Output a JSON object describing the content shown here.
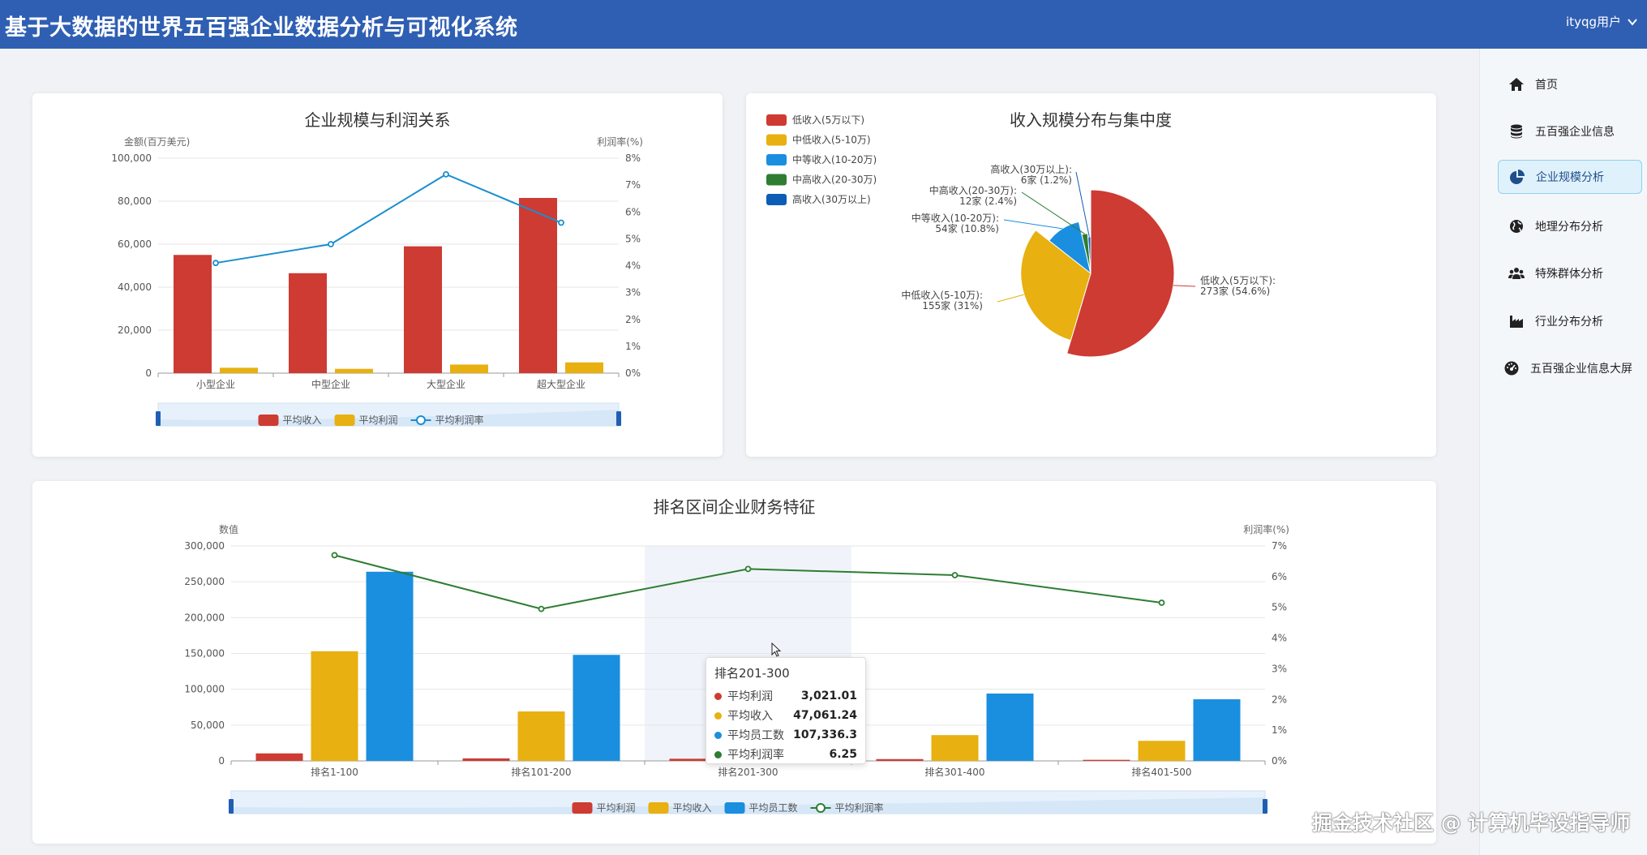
{
  "header": {
    "title": "基于大数据的世界五百强企业数据分析与可视化系统",
    "user": "ityqg用户"
  },
  "sidebar": {
    "items": [
      {
        "label": "首页",
        "icon": "home-icon",
        "active": false
      },
      {
        "label": "五百强企业信息",
        "icon": "database-icon",
        "active": false
      },
      {
        "label": "企业规模分析",
        "icon": "pie-chart-icon",
        "active": true
      },
      {
        "label": "地理分布分析",
        "icon": "globe-icon",
        "active": false
      },
      {
        "label": "特殊群体分析",
        "icon": "users-icon",
        "active": false
      },
      {
        "label": "行业分布分析",
        "icon": "factory-icon",
        "active": false
      },
      {
        "label": "五百强企业信息大屏",
        "icon": "dashboard-icon",
        "active": false
      }
    ]
  },
  "chart_data": [
    {
      "type": "bar",
      "title": "企业规模与利润关系",
      "ylabel": "金额(百万美元)",
      "y2label": "利润率(%)",
      "categories": [
        "小型企业",
        "中型企业",
        "大型企业",
        "超大型企业"
      ],
      "ylim": [
        0,
        100000
      ],
      "yticks": [
        "0",
        "20,000",
        "40,000",
        "60,000",
        "80,000",
        "100,000"
      ],
      "y2lim": [
        0,
        8
      ],
      "y2ticks": [
        "0%",
        "1%",
        "2%",
        "3%",
        "4%",
        "5%",
        "6%",
        "7%",
        "8%"
      ],
      "series": [
        {
          "name": "平均收入",
          "kind": "bar",
          "color": "#cd3b33",
          "values": [
            55000,
            46500,
            59000,
            81500
          ]
        },
        {
          "name": "平均利润",
          "kind": "bar",
          "color": "#e8b010",
          "values": [
            2500,
            2000,
            4000,
            5000
          ]
        },
        {
          "name": "平均利润率",
          "kind": "line",
          "axis": "right",
          "color": "#1a8fcf",
          "values": [
            4.1,
            4.8,
            7.4,
            5.6
          ]
        }
      ]
    },
    {
      "type": "pie",
      "title": "收入规模分布与集中度",
      "legend_position": "top-left",
      "slices": [
        {
          "name": "低收入(5万以下)",
          "value": 273,
          "percent": 54.6,
          "color": "#cd3b33",
          "label1": "低收入(5万以下):",
          "label2": "273家 (54.6%)"
        },
        {
          "name": "中低收入(5-10万)",
          "value": 155,
          "percent": 31,
          "color": "#e8b010",
          "label1": "中低收入(5-10万):",
          "label2": "155家 (31%)"
        },
        {
          "name": "中等收入(10-20万)",
          "value": 54,
          "percent": 10.8,
          "color": "#1a8fdf",
          "label1": "中等收入(10-20万):",
          "label2": "54家 (10.8%)"
        },
        {
          "name": "中高收入(20-30万)",
          "value": 12,
          "percent": 2.4,
          "color": "#2e7d32",
          "label1": "中高收入(20-30万):",
          "label2": "12家 (2.4%)"
        },
        {
          "name": "高收入(30万以上)",
          "value": 6,
          "percent": 1.2,
          "color": "#0d5cb6",
          "label1": "高收入(30万以上):",
          "label2": "6家 (1.2%)"
        }
      ]
    },
    {
      "type": "bar",
      "title": "排名区间企业财务特征",
      "ylabel": "数值",
      "y2label": "利润率(%)",
      "categories": [
        "排名1-100",
        "排名101-200",
        "排名201-300",
        "排名301-400",
        "排名401-500"
      ],
      "ylim": [
        0,
        300000
      ],
      "yticks": [
        "0",
        "50,000",
        "100,000",
        "150,000",
        "200,000",
        "250,000",
        "300,000"
      ],
      "y2lim": [
        0,
        7
      ],
      "y2ticks": [
        "0%",
        "1%",
        "2%",
        "3%",
        "4%",
        "5%",
        "6%",
        "7%"
      ],
      "series": [
        {
          "name": "平均利润",
          "kind": "bar",
          "color": "#cd3b33",
          "values": [
            10500,
            3500,
            3021.01,
            2500,
            1500
          ]
        },
        {
          "name": "平均收入",
          "kind": "bar",
          "color": "#e8b010",
          "values": [
            153000,
            69000,
            47061.24,
            36000,
            28000
          ]
        },
        {
          "name": "平均员工数",
          "kind": "bar",
          "color": "#1a8fdf",
          "values": [
            264000,
            148000,
            107336.3,
            94000,
            86000
          ]
        },
        {
          "name": "平均利润率",
          "kind": "line",
          "axis": "right",
          "color": "#2e7d32",
          "values": [
            6.7,
            4.95,
            6.25,
            6.05,
            5.15
          ]
        }
      ],
      "tooltip": {
        "title": "排名201-300",
        "rows": [
          {
            "label": "平均利润",
            "value": "3,021.01",
            "color": "#cd3b33"
          },
          {
            "label": "平均收入",
            "value": "47,061.24",
            "color": "#e8b010"
          },
          {
            "label": "平均员工数",
            "value": "107,336.3",
            "color": "#1a8fdf"
          },
          {
            "label": "平均利润率",
            "value": "6.25",
            "color": "#2e7d32"
          }
        ]
      }
    }
  ],
  "watermark": "掘金技术社区 @ 计算机毕设指导师"
}
